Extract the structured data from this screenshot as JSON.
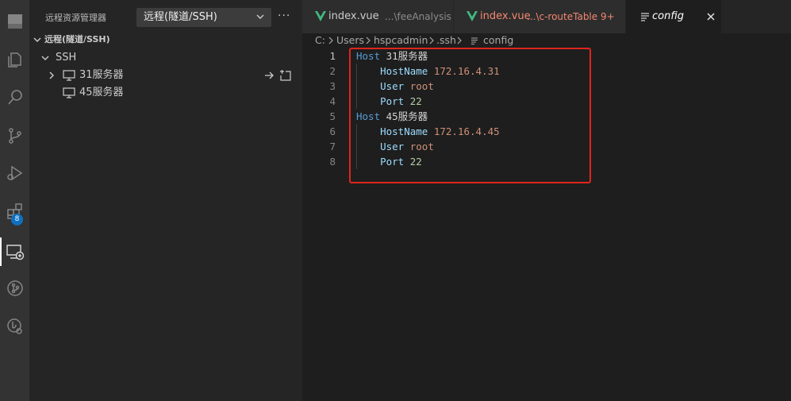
{
  "activity_bar": {
    "icons": [
      "explorer-icon",
      "files-icon",
      "search-icon",
      "source-control-icon",
      "run-debug-icon",
      "extensions-icon",
      "remote-explorer-icon",
      "git-graph-icon",
      "gitlens-icon"
    ],
    "extensions_badge": "8"
  },
  "sidebar": {
    "title": "远程资源管理器",
    "remote_select": "远程(隧道/SSH)",
    "more": "···",
    "section": "远程(隧道/SSH)",
    "group": "SSH",
    "hosts": [
      {
        "label": "31服务器"
      },
      {
        "label": "45服务器"
      }
    ]
  },
  "tabs": [
    {
      "name": "index.vue",
      "desc": "...\\feeAnalysis",
      "name_color": "#cccccc",
      "desc_color": "#8c8c8c"
    },
    {
      "name": "index.vue",
      "desc": "...\\c-routeTable  9+",
      "name_color": "#f48771",
      "desc_color": "#f48771"
    },
    {
      "name": "config",
      "active": true
    }
  ],
  "breadcrumb": [
    "C:",
    "Users",
    "hspcadmin",
    ".ssh",
    "config"
  ],
  "editor": {
    "lines": [
      {
        "num": "1",
        "parts": [
          [
            "kw-host",
            "Host"
          ],
          [
            "host-name",
            " 31服务器"
          ]
        ]
      },
      {
        "num": "2",
        "parts": [
          [
            "plain",
            "    "
          ],
          [
            "kw-key",
            "HostName"
          ],
          [
            "plain",
            " "
          ],
          [
            "val-ip",
            "172.16.4.31"
          ]
        ]
      },
      {
        "num": "3",
        "parts": [
          [
            "plain",
            "    "
          ],
          [
            "kw-key",
            "User"
          ],
          [
            "plain",
            " "
          ],
          [
            "val-name",
            "root"
          ]
        ]
      },
      {
        "num": "4",
        "parts": [
          [
            "plain",
            "    "
          ],
          [
            "kw-key",
            "Port"
          ],
          [
            "plain",
            " "
          ],
          [
            "val-num",
            "22"
          ]
        ]
      },
      {
        "num": "5",
        "parts": [
          [
            "kw-host",
            "Host"
          ],
          [
            "host-name",
            " 45服务器"
          ]
        ]
      },
      {
        "num": "6",
        "parts": [
          [
            "plain",
            "    "
          ],
          [
            "kw-key",
            "HostName"
          ],
          [
            "plain",
            " "
          ],
          [
            "val-ip",
            "172.16.4.45"
          ]
        ]
      },
      {
        "num": "7",
        "parts": [
          [
            "plain",
            "    "
          ],
          [
            "kw-key",
            "User"
          ],
          [
            "plain",
            " "
          ],
          [
            "val-name",
            "root"
          ]
        ]
      },
      {
        "num": "8",
        "parts": [
          [
            "plain",
            "    "
          ],
          [
            "kw-key",
            "Port"
          ],
          [
            "plain",
            " "
          ],
          [
            "val-num",
            "22"
          ]
        ]
      }
    ]
  },
  "colors": {
    "accent": "#0e70c0",
    "highlight_box": "#e0251c",
    "vue_green": "#41b883"
  }
}
